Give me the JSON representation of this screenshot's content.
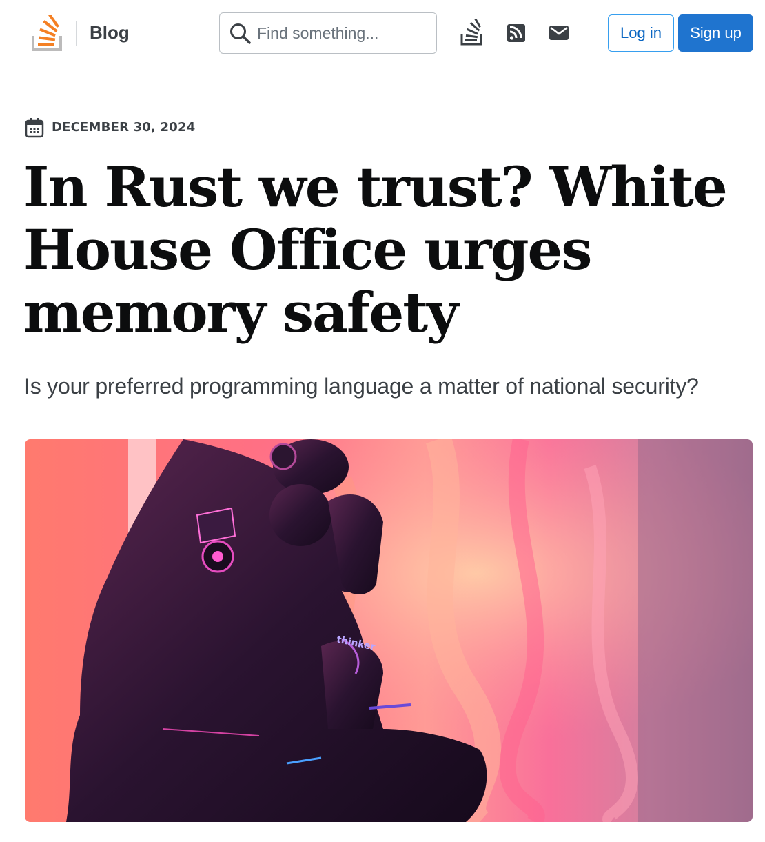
{
  "header": {
    "section_label": "Blog",
    "search": {
      "placeholder": "Find something..."
    },
    "nav_icons": [
      "stack-overflow-icon",
      "rss-icon",
      "mail-icon"
    ],
    "login_label": "Log in",
    "signup_label": "Sign up"
  },
  "article": {
    "date": "DECEMBER 30, 2024",
    "title": "In Rust we trust? White House Office urges memory safety",
    "subtitle": "Is your preferred programming language a matter of national security?",
    "hero_image": {
      "subject": "robot-thinker-illustration",
      "arm_text": "thinker"
    }
  },
  "colors": {
    "brand_orange": "#f48024",
    "logo_gray": "#bcbbbb",
    "primary_blue": "#1f74cf",
    "link_blue": "#0a66c2",
    "text_dark": "#0c0d0e",
    "text_muted": "#3b4045"
  }
}
